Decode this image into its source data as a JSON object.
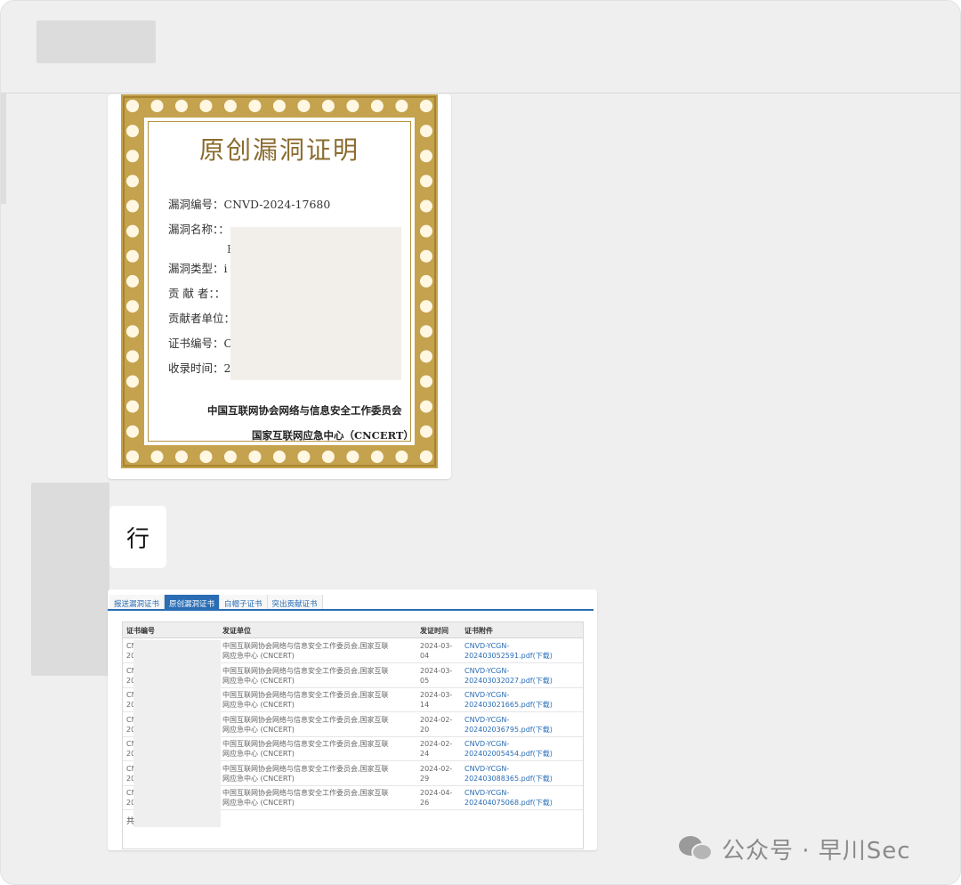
{
  "certificate": {
    "title": "原创漏洞证明",
    "fields": [
      {
        "label": "漏洞编号：",
        "value": "CNVD-2024-17680"
      },
      {
        "label": "漏洞名称：",
        "value": "："
      },
      {
        "label": "漏洞类型：",
        "value": "i"
      },
      {
        "label": "贡 献 者：",
        "value": "："
      },
      {
        "label": "贡献者单位：",
        "value": ""
      },
      {
        "label": "证书编号：",
        "value": "C"
      },
      {
        "label": "收录时间：",
        "value": "2"
      }
    ],
    "name_line2": "F",
    "issuer_line1": "中国互联网协会网络与信息安全工作委员会",
    "issuer_line2": "国家互联网应急中心（CNCERT）"
  },
  "chat": {
    "bubble_text": "行"
  },
  "portal": {
    "tabs": [
      "报送漏洞证书",
      "原创漏洞证书",
      "白帽子证书",
      "突出贡献证书"
    ],
    "active_tab": 1,
    "columns": [
      "证书编号",
      "发证单位",
      "发证时间",
      "证书附件"
    ],
    "rows": [
      {
        "id": "CN",
        "id2": "20",
        "org1": "中国互联网协会网络与信息安全工作委员会,国家互联",
        "org2": "网应急中心 (CNCERT)",
        "date1": "2024-03-",
        "date2": "04",
        "file1": "CNVD-YCGN-",
        "file2": "202403052591.pdf(下载)"
      },
      {
        "id": "CN",
        "id2": "20",
        "org1": "中国互联网协会网络与信息安全工作委员会,国家互联",
        "org2": "网应急中心 (CNCERT)",
        "date1": "2024-03-",
        "date2": "05",
        "file1": "CNVD-YCGN-",
        "file2": "202403032027.pdf(下载)"
      },
      {
        "id": "CN",
        "id2": "20",
        "org1": "中国互联网协会网络与信息安全工作委员会,国家互联",
        "org2": "网应急中心 (CNCERT)",
        "date1": "2024-03-",
        "date2": "14",
        "file1": "CNVD-YCGN-",
        "file2": "202403021665.pdf(下载)"
      },
      {
        "id": "CN",
        "id2": "20",
        "org1": "中国互联网协会网络与信息安全工作委员会,国家互联",
        "org2": "网应急中心 (CNCERT)",
        "date1": "2024-02-",
        "date2": "20",
        "file1": "CNVD-YCGN-",
        "file2": "202402036795.pdf(下载)"
      },
      {
        "id": "CN",
        "id2": "20",
        "org1": "中国互联网协会网络与信息安全工作委员会,国家互联",
        "org2": "网应急中心 (CNCERT)",
        "date1": "2024-02-",
        "date2": "24",
        "file1": "CNVD-YCGN-",
        "file2": "202402005454.pdf(下载)"
      },
      {
        "id": "CN",
        "id2": "20",
        "org1": "中国互联网协会网络与信息安全工作委员会,国家互联",
        "org2": "网应急中心 (CNCERT)",
        "date1": "2024-02-",
        "date2": "29",
        "file1": "CNVD-YCGN-",
        "file2": "202403088365.pdf(下载)"
      },
      {
        "id": "CN",
        "id2": "20",
        "org1": "中国互联网协会网络与信息安全工作委员会,国家互联",
        "org2": "网应急中心 (CNCERT)",
        "date1": "2024-04-",
        "date2": "26",
        "file1": "CNVD-YCGN-",
        "file2": "202404075068.pdf(下载)"
      }
    ],
    "footer_char": "共"
  },
  "watermark": {
    "text": "公众号 · 早川Sec",
    "icon": "wechat-icon"
  }
}
